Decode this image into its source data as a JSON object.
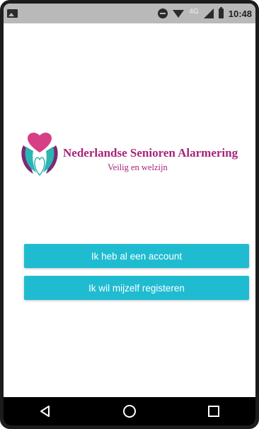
{
  "status_bar": {
    "network": "4G",
    "time": "10:48",
    "icons": [
      "image-icon",
      "do-not-disturb-icon",
      "wifi-icon",
      "signal-icon",
      "battery-icon"
    ]
  },
  "logo": {
    "title": "Nederlandse Senioren Alarmering",
    "subtitle": "Veilig en welzijn",
    "colors": {
      "heart": "#d63e86",
      "wing_teal": "#2bb5b4",
      "wing_purple": "#7b2a72",
      "text": "#a7247a"
    }
  },
  "buttons": {
    "login_label": "Ik heb al een account",
    "register_label": "Ik wil mijzelf registeren",
    "color": "#1fbcd1"
  },
  "nav_bar": {
    "icons": [
      "back-icon",
      "home-icon",
      "recents-icon"
    ]
  }
}
